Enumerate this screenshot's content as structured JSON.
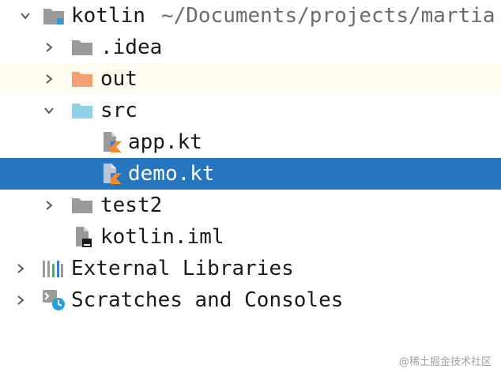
{
  "colors": {
    "selection": "#2675bf",
    "highlight_row": "#fffdf0",
    "folder_gray": "#9a9a9a",
    "folder_orange": "#f5a073",
    "folder_blue": "#8fd0ea",
    "kotlin_orange": "#f08a2c",
    "kotlin_blue": "#3a7bd5"
  },
  "tree": {
    "root": {
      "label": "kotlin",
      "path": "~/Documents/projects/martia",
      "icon": "module-folder-icon",
      "expanded": true
    },
    "items": [
      {
        "label": ".idea",
        "icon": "folder-icon",
        "expanded": false
      },
      {
        "label": "out",
        "icon": "excluded-folder-icon",
        "expanded": false
      },
      {
        "label": "src",
        "icon": "source-folder-icon",
        "expanded": true
      },
      {
        "label": "app.kt",
        "icon": "kotlin-file-icon"
      },
      {
        "label": "demo.kt",
        "icon": "kotlin-file-icon",
        "selected": true
      },
      {
        "label": "test2",
        "icon": "folder-icon",
        "expanded": false
      },
      {
        "label": "kotlin.iml",
        "icon": "iml-file-icon"
      },
      {
        "label": "External Libraries",
        "icon": "libraries-icon",
        "expanded": false
      },
      {
        "label": "Scratches and Consoles",
        "icon": "scratches-icon",
        "expanded": false
      }
    ]
  },
  "watermark": "@稀土掘金技术社区"
}
